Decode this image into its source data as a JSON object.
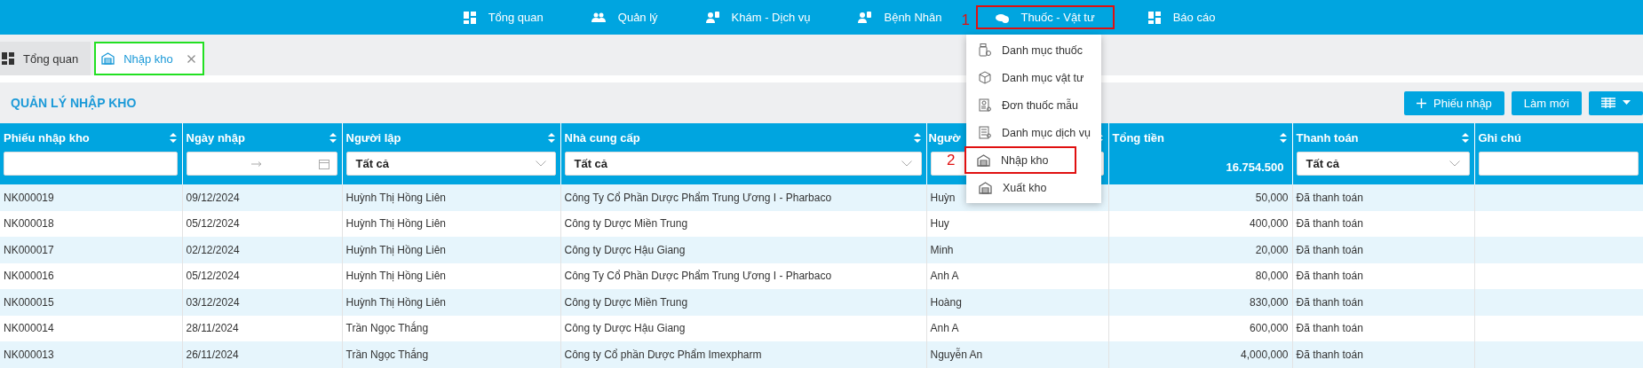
{
  "nav": [
    {
      "label": "Tổng quan",
      "outlined": false
    },
    {
      "label": "Quản lý",
      "outlined": false
    },
    {
      "label": "Khám - Dịch vụ",
      "outlined": false
    },
    {
      "label": "Bệnh Nhân",
      "outlined": false
    },
    {
      "label": "Thuốc - Vật tư",
      "outlined": true,
      "marker": "1"
    },
    {
      "label": "Báo cáo",
      "outlined": false
    }
  ],
  "tabs": [
    {
      "label": "Tổng quan",
      "selected": false,
      "closable": false,
      "outlined": false
    },
    {
      "label": "Nhập kho",
      "selected": true,
      "closable": true,
      "outlined": true
    }
  ],
  "page_title": "QUẢN LÝ NHẬP KHO",
  "toolbar": [
    {
      "label": "Phiếu nhập",
      "kind": "add"
    },
    {
      "label": "Làm mới",
      "kind": "plain"
    },
    {
      "kind": "columns"
    }
  ],
  "menu": [
    {
      "label": "Danh mục thuốc",
      "outlined": false
    },
    {
      "label": "Danh mục vật tư",
      "outlined": false
    },
    {
      "label": "Đơn thuốc mẫu",
      "outlined": false
    },
    {
      "label": "Danh mục dịch vụ",
      "outlined": false
    },
    {
      "label": "Nhập kho",
      "outlined": true,
      "marker": "2"
    },
    {
      "label": "Xuất kho",
      "outlined": false
    }
  ],
  "table": {
    "columns": [
      {
        "label": "Phiếu nhập kho",
        "filter": {
          "kind": "text"
        }
      },
      {
        "label": "Ngày nhập",
        "filter": {
          "kind": "date_range"
        }
      },
      {
        "label": "Người lập",
        "filter": {
          "kind": "select",
          "value": "Tất cả"
        }
      },
      {
        "label": "Nhà cung cấp",
        "filter": {
          "kind": "select",
          "value": "Tất cả"
        }
      },
      {
        "label": "Ngườ",
        "filter": {
          "kind": "text"
        }
      },
      {
        "label": "Tổng tiền",
        "filter": {
          "kind": "total",
          "value": "16.754.500"
        }
      },
      {
        "label": "Thanh toán",
        "filter": {
          "kind": "select",
          "value": "Tất cả"
        }
      },
      {
        "label": "Ghi chú",
        "filter": {
          "kind": "text"
        }
      }
    ],
    "rows": [
      [
        "NK000019",
        "09/12/2024",
        "Huỳnh Thị Hồng Liên",
        "Công Ty Cổ Phần Dược Phẩm Trung Ương I - Pharbaco",
        "Huỳn",
        "50,000",
        "Đã thanh toán",
        ""
      ],
      [
        "NK000018",
        "05/12/2024",
        "Huỳnh Thị Hồng Liên",
        "Công ty Dược Miền Trung",
        "Huy",
        "400,000",
        "Đã thanh toán",
        ""
      ],
      [
        "NK000017",
        "02/12/2024",
        "Huỳnh Thị Hồng Liên",
        "Công ty Dược Hậu Giang",
        "Minh",
        "20,000",
        "Đã thanh toán",
        ""
      ],
      [
        "NK000016",
        "05/12/2024",
        "Huỳnh Thị Hồng Liên",
        "Công Ty Cổ Phần Dược Phẩm Trung Ương I - Pharbaco",
        "Anh A",
        "80,000",
        "Đã thanh toán",
        ""
      ],
      [
        "NK000015",
        "03/12/2024",
        "Huỳnh Thị Hồng Liên",
        "Công ty Dược Miền Trung",
        "Hoàng",
        "830,000",
        "Đã thanh toán",
        ""
      ],
      [
        "NK000014",
        "28/11/2024",
        "Trần Ngọc Thắng",
        "Công ty Dược Hậu Giang",
        "Anh A",
        "600,000",
        "Đã thanh toán",
        ""
      ],
      [
        "NK000013",
        "26/11/2024",
        "Trần Ngọc Thắng",
        "Công ty Cổ phần Dược Phẩm Imexpharm",
        "Nguyễn An",
        "4,000,000",
        "Đã thanh toán",
        ""
      ]
    ]
  }
}
